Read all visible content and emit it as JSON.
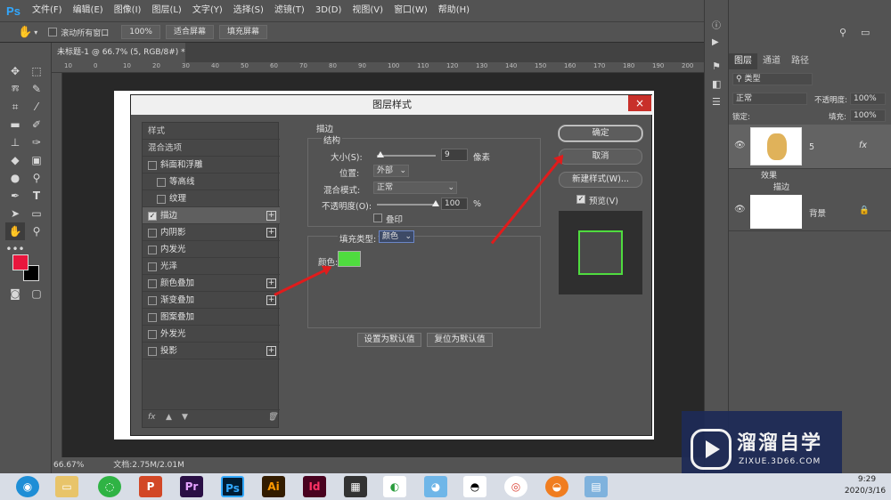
{
  "app": {
    "logo": "Ps",
    "menus": [
      "文件(F)",
      "编辑(E)",
      "图像(I)",
      "图层(L)",
      "文字(Y)",
      "选择(S)",
      "滤镜(T)",
      "3D(D)",
      "视图(V)",
      "窗口(W)",
      "帮助(H)"
    ]
  },
  "options": {
    "scroll_all": "滚动所有窗口",
    "zoom": "100%",
    "fit_screen": "适合屏幕",
    "fill_screen": "填充屏幕"
  },
  "document": {
    "tab": "未标题-1 @ 66.7% (5, RGB/8#) *",
    "tab_close": "×"
  },
  "ruler": {
    "ticks": [
      "10",
      "0",
      "10",
      "20",
      "30",
      "40",
      "50",
      "60",
      "70",
      "80",
      "90",
      "100",
      "110",
      "120",
      "130",
      "140",
      "150",
      "160",
      "170",
      "180",
      "190",
      "200"
    ]
  },
  "status": {
    "zoom": "66.67%",
    "doc": "文档:2.75M/2.01M"
  },
  "dialog": {
    "title": "图层样式",
    "close": "×",
    "styles": [
      {
        "label": "样式",
        "check": false,
        "plus": false,
        "indent": false,
        "active": false
      },
      {
        "label": "混合选项",
        "check": false,
        "plus": false,
        "indent": false,
        "active": false
      },
      {
        "label": "斜面和浮雕",
        "check": true,
        "checked": false,
        "plus": false,
        "indent": false
      },
      {
        "label": "等高线",
        "check": true,
        "checked": false,
        "plus": false,
        "indent": true
      },
      {
        "label": "纹理",
        "check": true,
        "checked": false,
        "plus": false,
        "indent": true
      },
      {
        "label": "描边",
        "check": true,
        "checked": true,
        "plus": true,
        "indent": false,
        "active": true
      },
      {
        "label": "内阴影",
        "check": true,
        "checked": false,
        "plus": true,
        "indent": false
      },
      {
        "label": "内发光",
        "check": true,
        "checked": false,
        "plus": false,
        "indent": false
      },
      {
        "label": "光泽",
        "check": true,
        "checked": false,
        "plus": false,
        "indent": false
      },
      {
        "label": "颜色叠加",
        "check": true,
        "checked": false,
        "plus": true,
        "indent": false
      },
      {
        "label": "渐变叠加",
        "check": true,
        "checked": false,
        "plus": true,
        "indent": false
      },
      {
        "label": "图案叠加",
        "check": true,
        "checked": false,
        "plus": false,
        "indent": false
      },
      {
        "label": "外发光",
        "check": true,
        "checked": false,
        "plus": false,
        "indent": false
      },
      {
        "label": "投影",
        "check": true,
        "checked": false,
        "plus": true,
        "indent": false
      }
    ],
    "list_footer": {
      "fx": "fx",
      "up": "▲",
      "down": "▼",
      "trash": "🗑"
    },
    "stroke": {
      "section": "描边",
      "structure": "结构",
      "size_label": "大小(S):",
      "size_value": "9",
      "size_unit": "像素",
      "position_label": "位置:",
      "position_value": "外部",
      "blend_label": "混合模式:",
      "blend_value": "正常",
      "opacity_label": "不透明度(O):",
      "opacity_value": "100",
      "opacity_unit": "%",
      "overprint": "叠印",
      "fill_type_label": "填充类型:",
      "fill_type_value": "颜色",
      "color_label": "颜色:",
      "color": "#4fdc3f",
      "set_default": "设置为默认值",
      "reset_default": "复位为默认值"
    },
    "ok": "确定",
    "cancel": "取消",
    "new_style": "新建样式(W)...",
    "preview": "预览(V)"
  },
  "layers_panel": {
    "tabs": [
      "图层",
      "通道",
      "路径"
    ],
    "filter": "类型",
    "blend": "正常",
    "opacity_label": "不透明度:",
    "opacity": "100%",
    "lock_label": "锁定:",
    "fill_label": "填充:",
    "fill": "100%",
    "layer1": {
      "name": "5",
      "fx": "fx",
      "effects": "效果",
      "stroke": "描边"
    },
    "layer2": {
      "name": "背景"
    }
  },
  "taskbar": {
    "time": "9:29",
    "date": "2020/3/16",
    "apps": [
      "Pr",
      "Ps",
      "Ai",
      "Id"
    ]
  },
  "watermark": {
    "title": "溜溜自学",
    "url": "ZIXUE.3D66.COM"
  },
  "colors": {
    "foreground": "#e8163d",
    "background": "#000000",
    "arrow": "#e01c1c",
    "accent": "#31a8ff"
  }
}
